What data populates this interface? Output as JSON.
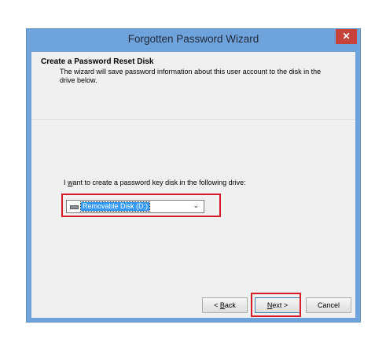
{
  "window": {
    "title": "Forgotten Password Wizard",
    "close_glyph": "✕"
  },
  "header": {
    "title": "Create a Password Reset Disk",
    "description": "The wizard will save password information about this user account to the disk in the drive below."
  },
  "drive": {
    "label_prefix": "I ",
    "label_mnemonic": "w",
    "label_rest": "ant to create a password key disk in the following drive:",
    "selected": "Removable Disk (D:)",
    "icon": "removable-disk-icon",
    "chevron": "⌄"
  },
  "buttons": {
    "back_prefix": "< ",
    "back_mnemonic": "B",
    "back_rest": "ack",
    "next_mnemonic": "N",
    "next_rest": "ext >",
    "cancel": "Cancel"
  },
  "colors": {
    "titlebar": "#6fa3dc",
    "close": "#c7433a",
    "highlight_red": "#d61b2a",
    "selection": "#3399ff"
  }
}
